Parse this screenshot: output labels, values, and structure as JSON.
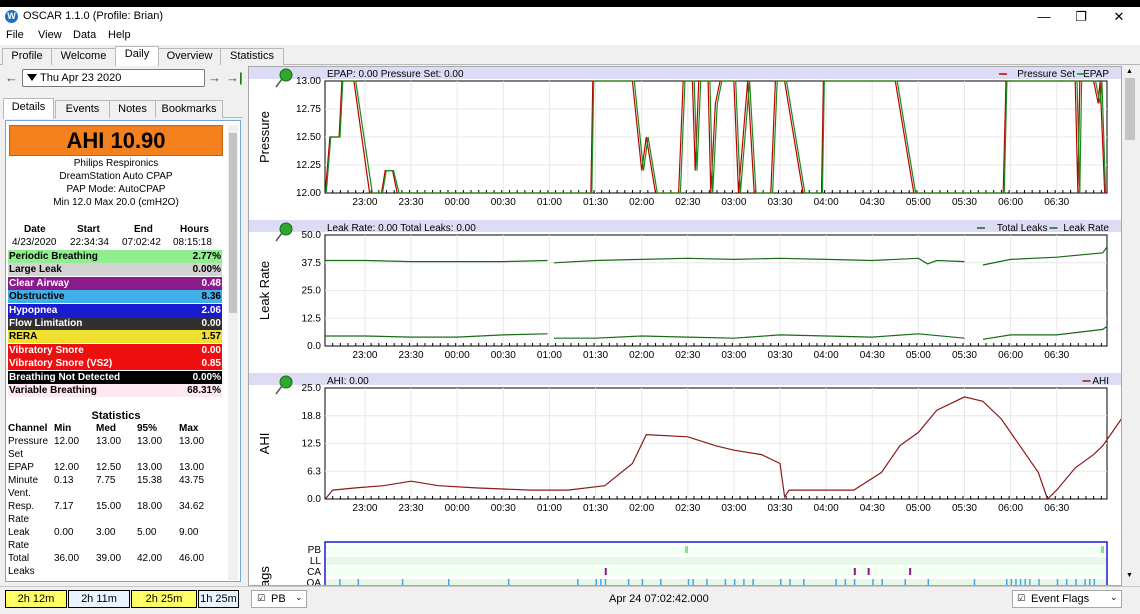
{
  "window": {
    "title": "OSCAR 1.1.0 (Profile: Brian)",
    "minimize_icon": "minimize-icon",
    "maximize_icon": "restore-icon",
    "close_icon": "close-icon"
  },
  "menu": [
    "File",
    "View",
    "Data",
    "Help"
  ],
  "main_tabs": [
    "Profile",
    "Welcome",
    "Daily",
    "Overview",
    "Statistics"
  ],
  "active_tab": "Daily",
  "date_nav": {
    "date": "Thu Apr 23 2020",
    "prev_icon": "arrow-left-icon",
    "next_icon": "arrow-right-icon",
    "last_icon": "jump-to-end-icon"
  },
  "sub_tabs": [
    "Details",
    "Events",
    "Notes",
    "Bookmarks"
  ],
  "details": {
    "ahi_label": "AHI 10.90",
    "device": [
      "Philips Respironics",
      "DreamStation Auto CPAP",
      "PAP Mode: AutoCPAP",
      "Min 12.0 Max 20.0 (cmH2O)"
    ],
    "session_headers": [
      "Date",
      "Start",
      "End",
      "Hours"
    ],
    "session_values": [
      "4/23/2020",
      "22:34:34",
      "07:02:42",
      "08:15:18"
    ],
    "events": [
      {
        "name": "Periodic Breathing",
        "value": "2.77%",
        "bg": "#90ee90",
        "fg": "#000000"
      },
      {
        "name": "Large Leak",
        "value": "0.00%",
        "bg": "#d3d3d3",
        "fg": "#000000"
      },
      {
        "name": "Clear Airway",
        "value": "0.48",
        "bg": "#8b1a8b",
        "fg": "#ffffff"
      },
      {
        "name": "Obstructive",
        "value": "8.36",
        "bg": "#40b0e8",
        "fg": "#000000"
      },
      {
        "name": "Hypopnea",
        "value": "2.06",
        "bg": "#1a1ad0",
        "fg": "#ffffff"
      },
      {
        "name": "Flow Limitation",
        "value": "0.00",
        "bg": "#303030",
        "fg": "#ffffff"
      },
      {
        "name": "RERA",
        "value": "1.57",
        "bg": "#f0e030",
        "fg": "#000000"
      },
      {
        "name": "Vibratory Snore",
        "value": "0.00",
        "bg": "#ee1010",
        "fg": "#ffffff"
      },
      {
        "name": "Vibratory Snore (VS2)",
        "value": "0.85",
        "bg": "#ee1010",
        "fg": "#ffffff"
      },
      {
        "name": "Breathing Not Detected",
        "value": "0.00%",
        "bg": "#000000",
        "fg": "#ffffff"
      },
      {
        "name": "Variable Breathing",
        "value": "68.31%",
        "bg": "#ffe8f0",
        "fg": "#000000"
      }
    ],
    "statistics_title": "Statistics",
    "stat_headers": [
      "Channel",
      "Min",
      "Med",
      "95%",
      "Max"
    ],
    "stats": [
      {
        "channel": [
          "Pressure",
          "Set"
        ],
        "min": "12.00",
        "med": "13.00",
        "p95": "13.00",
        "max": "13.00"
      },
      {
        "channel": [
          "EPAP"
        ],
        "min": "12.00",
        "med": "12.50",
        "p95": "13.00",
        "max": "13.00"
      },
      {
        "channel": [
          "Minute",
          "Vent."
        ],
        "min": "0.13",
        "med": "7.75",
        "p95": "15.38",
        "max": "43.75"
      },
      {
        "channel": [
          "Resp.",
          "Rate"
        ],
        "min": "7.17",
        "med": "15.00",
        "p95": "18.00",
        "max": "34.62"
      },
      {
        "channel": [
          "Leak",
          "Rate"
        ],
        "min": "0.00",
        "med": "3.00",
        "p95": "5.00",
        "max": "9.00"
      },
      {
        "channel": [
          "Total",
          "Leaks"
        ],
        "min": "36.00",
        "med": "39.00",
        "p95": "42.00",
        "max": "46.00"
      }
    ]
  },
  "durations": [
    "2h 12m",
    "2h 11m",
    "2h 25m",
    "1h 25m"
  ],
  "footer": {
    "left_check": "PB",
    "center_text": "Apr 24 07:02:42.000",
    "right_label": "Event Flags"
  },
  "graphs": {
    "time_ticks": [
      "23:00",
      "23:30",
      "00:00",
      "00:30",
      "01:00",
      "01:30",
      "02:00",
      "02:30",
      "03:00",
      "03:30",
      "04:00",
      "04:30",
      "05:00",
      "05:30",
      "06:00",
      "06:30"
    ],
    "pressure": {
      "ylabel": "Pressure",
      "header": "EPAP: 0.00 Pressure Set: 0.00",
      "legend": [
        "Pressure Set",
        "EPAP"
      ],
      "yticks": [
        "13.00",
        "12.75",
        "12.50",
        "12.25",
        "12.00"
      ]
    },
    "leak": {
      "ylabel": "Leak Rate",
      "header": "Leak Rate: 0.00 Total Leaks: 0.00",
      "legend": [
        "Total Leaks",
        "Leak Rate"
      ],
      "yticks": [
        "50.0",
        "37.5",
        "25.0",
        "12.5",
        "0.0"
      ]
    },
    "ahi": {
      "ylabel": "AHI",
      "header": "AHI: 0.00",
      "legend": [
        "AHI"
      ],
      "yticks": [
        "25.0",
        "18.8",
        "12.5",
        "6.3",
        "0.0"
      ]
    },
    "flags": {
      "ylabel": "Flags",
      "rows": [
        "PB",
        "LL",
        "CA",
        "OA"
      ]
    },
    "pin_icon": "pushpin-icon"
  },
  "chart_data": [
    {
      "type": "line",
      "xlabel": "",
      "ylabel": "Pressure",
      "ylim": [
        12,
        13
      ],
      "x_range": [
        "22:34",
        "07:02"
      ],
      "series": [
        {
          "name": "Pressure Set",
          "color": "#c00000",
          "points": [
            [
              22.57,
              12.0
            ],
            [
              22.62,
              12.5
            ],
            [
              22.72,
              12.5
            ],
            [
              22.75,
              13.0
            ],
            [
              22.88,
              13.0
            ],
            [
              23.05,
              12.0
            ],
            [
              23.18,
              12.0
            ],
            [
              23.22,
              12.2
            ],
            [
              23.3,
              12.2
            ],
            [
              23.35,
              12.0
            ],
            [
              1.45,
              12.0
            ],
            [
              1.47,
              13.0
            ],
            [
              1.9,
              13.0
            ],
            [
              2.0,
              12.2
            ],
            [
              2.05,
              12.5
            ],
            [
              2.15,
              12.0
            ],
            [
              2.4,
              12.0
            ],
            [
              2.45,
              13.0
            ],
            [
              2.55,
              13.0
            ],
            [
              2.58,
              12.2
            ],
            [
              2.62,
              13.0
            ],
            [
              2.72,
              13.0
            ],
            [
              2.75,
              12.0
            ],
            [
              2.8,
              12.8
            ],
            [
              2.85,
              13.0
            ],
            [
              3.0,
              13.0
            ],
            [
              3.05,
              12.0
            ],
            [
              3.1,
              12.5
            ],
            [
              3.15,
              13.0
            ],
            [
              3.22,
              12.0
            ],
            [
              3.4,
              12.0
            ],
            [
              3.45,
              13.0
            ],
            [
              3.55,
              13.0
            ],
            [
              3.65,
              12.5
            ],
            [
              3.75,
              12.0
            ],
            [
              3.95,
              12.0
            ],
            [
              3.97,
              13.0
            ],
            [
              4.75,
              13.0
            ],
            [
              4.95,
              12.0
            ],
            [
              5.92,
              12.0
            ],
            [
              5.95,
              13.0
            ],
            [
              6.7,
              13.0
            ],
            [
              6.73,
              12.0
            ],
            [
              6.75,
              13.0
            ],
            [
              6.9,
              13.0
            ],
            [
              6.95,
              12.8
            ],
            [
              6.97,
              13.0
            ],
            [
              7.02,
              12.0
            ]
          ]
        },
        {
          "name": "EPAP",
          "color": "#1a8a1a",
          "points": [
            [
              22.58,
              12.0
            ],
            [
              22.63,
              12.5
            ],
            [
              22.73,
              12.5
            ],
            [
              22.76,
              13.0
            ],
            [
              22.9,
              13.0
            ],
            [
              23.08,
              12.0
            ],
            [
              23.19,
              12.0
            ],
            [
              23.23,
              12.2
            ],
            [
              23.31,
              12.2
            ],
            [
              23.37,
              12.0
            ],
            [
              1.46,
              12.0
            ],
            [
              1.48,
              13.0
            ],
            [
              1.92,
              13.0
            ],
            [
              2.02,
              12.2
            ],
            [
              2.07,
              12.5
            ],
            [
              2.17,
              12.0
            ],
            [
              2.42,
              12.0
            ],
            [
              2.47,
              13.0
            ],
            [
              2.57,
              13.0
            ],
            [
              2.6,
              12.2
            ],
            [
              2.64,
              13.0
            ],
            [
              2.74,
              13.0
            ],
            [
              2.77,
              12.0
            ],
            [
              2.82,
              12.8
            ],
            [
              2.87,
              13.0
            ],
            [
              3.02,
              13.0
            ],
            [
              3.07,
              12.0
            ],
            [
              3.12,
              12.5
            ],
            [
              3.17,
              13.0
            ],
            [
              3.24,
              12.0
            ],
            [
              3.42,
              12.0
            ],
            [
              3.47,
              13.0
            ],
            [
              3.57,
              13.0
            ],
            [
              3.67,
              12.5
            ],
            [
              3.77,
              12.0
            ],
            [
              3.96,
              12.0
            ],
            [
              3.98,
              13.0
            ],
            [
              4.77,
              13.0
            ],
            [
              4.97,
              12.0
            ],
            [
              5.93,
              12.0
            ],
            [
              5.96,
              13.0
            ],
            [
              6.72,
              13.0
            ],
            [
              6.75,
              12.0
            ],
            [
              6.77,
              13.0
            ],
            [
              6.92,
              13.0
            ],
            [
              6.97,
              12.8
            ],
            [
              6.99,
              13.0
            ],
            [
              7.03,
              12.0
            ]
          ]
        }
      ]
    },
    {
      "type": "line",
      "xlabel": "",
      "ylabel": "Leak Rate",
      "ylim": [
        0,
        50
      ],
      "series": [
        {
          "name": "Total Leaks",
          "color": "#1a6a1a",
          "points": [
            [
              22.57,
              38.5
            ],
            [
              23.0,
              38.5
            ],
            [
              23.5,
              38.0
            ],
            [
              24.0,
              38.0
            ],
            [
              24.5,
              38.0
            ],
            [
              24.98,
              38.5
            ],
            [
              25.0,
              null
            ],
            [
              25.05,
              37.5
            ],
            [
              25.5,
              38.5
            ],
            [
              26.0,
              39.0
            ],
            [
              26.5,
              39.5
            ],
            [
              27.0,
              39.0
            ],
            [
              27.5,
              39.5
            ],
            [
              28.0,
              39.0
            ],
            [
              28.5,
              38.5
            ],
            [
              29.0,
              39.5
            ],
            [
              29.1,
              37.0
            ],
            [
              29.2,
              38.5
            ],
            [
              29.5,
              38.0
            ],
            [
              29.6,
              null
            ],
            [
              29.7,
              36.5
            ],
            [
              30.0,
              39.0
            ],
            [
              30.5,
              40.0
            ],
            [
              31.0,
              42.0
            ],
            [
              31.05,
              45.0
            ]
          ]
        },
        {
          "name": "Leak Rate",
          "color": "#1a6a1a",
          "points": [
            [
              22.57,
              4.5
            ],
            [
              23.0,
              4.5
            ],
            [
              23.5,
              4.0
            ],
            [
              24.0,
              4.0
            ],
            [
              24.5,
              5.0
            ],
            [
              24.98,
              5.5
            ],
            [
              25.0,
              null
            ],
            [
              25.05,
              3.5
            ],
            [
              25.5,
              3.5
            ],
            [
              26.0,
              4.5
            ],
            [
              26.5,
              4.0
            ],
            [
              27.0,
              3.5
            ],
            [
              27.5,
              5.0
            ],
            [
              28.0,
              4.5
            ],
            [
              28.5,
              4.0
            ],
            [
              29.0,
              5.5
            ],
            [
              29.5,
              3.5
            ],
            [
              29.6,
              null
            ],
            [
              29.7,
              3.0
            ],
            [
              30.0,
              5.0
            ],
            [
              30.5,
              5.0
            ],
            [
              31.0,
              7.5
            ],
            [
              31.05,
              9.0
            ]
          ]
        }
      ]
    },
    {
      "type": "line",
      "xlabel": "",
      "ylabel": "AHI",
      "ylim": [
        0,
        25
      ],
      "series": [
        {
          "name": "AHI",
          "color": "#8b1a1a",
          "points": [
            [
              22.57,
              0.0
            ],
            [
              22.65,
              2.0
            ],
            [
              22.9,
              2.5
            ],
            [
              23.2,
              3.0
            ],
            [
              23.5,
              4.0
            ],
            [
              23.8,
              3.0
            ],
            [
              24.2,
              2.5
            ],
            [
              24.8,
              2.0
            ],
            [
              25.2,
              2.0
            ],
            [
              25.6,
              3.0
            ],
            [
              25.9,
              8.0
            ],
            [
              26.05,
              14.5
            ],
            [
              26.5,
              14.0
            ],
            [
              26.8,
              12.0
            ],
            [
              27.0,
              11.0
            ],
            [
              27.3,
              10.0
            ],
            [
              27.5,
              8.0
            ],
            [
              27.55,
              0.5
            ],
            [
              27.6,
              2.0
            ],
            [
              28.0,
              2.0
            ],
            [
              28.3,
              2.0
            ],
            [
              28.6,
              6.0
            ],
            [
              28.8,
              12.0
            ],
            [
              29.0,
              15.0
            ],
            [
              29.2,
              20.0
            ],
            [
              29.5,
              23.0
            ],
            [
              29.7,
              22.0
            ],
            [
              29.9,
              18.0
            ],
            [
              30.1,
              12.0
            ],
            [
              30.3,
              6.0
            ],
            [
              30.4,
              0.0
            ],
            [
              30.5,
              2.0
            ],
            [
              30.7,
              7.0
            ],
            [
              30.9,
              10.0
            ],
            [
              31.0,
              12.0
            ],
            [
              31.2,
              18.0
            ],
            [
              31.35,
              23.0
            ],
            [
              31.5,
              25.0
            ],
            [
              31.6,
              23.0
            ],
            [
              31.75,
              17.0
            ],
            [
              31.88,
              14.5
            ]
          ]
        }
      ]
    }
  ]
}
